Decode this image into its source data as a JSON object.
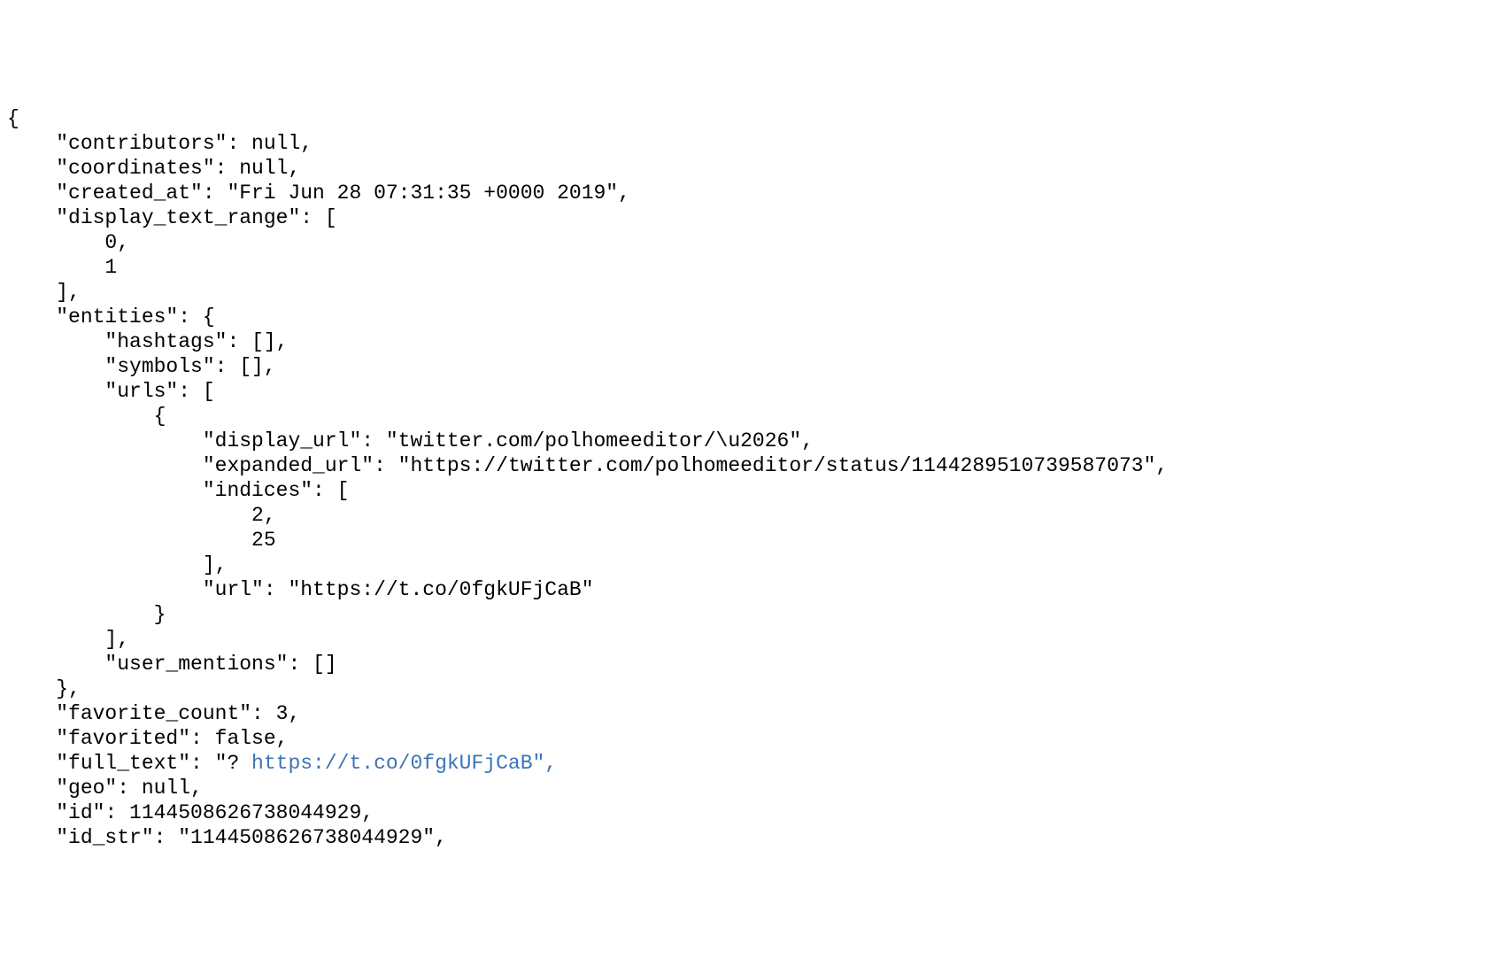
{
  "l0": "{",
  "l1": "    \"contributors\": null,",
  "l2": "    \"coordinates\": null,",
  "l3": "    \"created_at\": \"Fri Jun 28 07:31:35 +0000 2019\",",
  "l4": "    \"display_text_range\": [",
  "l5": "        0,",
  "l6": "        1",
  "l7": "    ],",
  "l8": "    \"entities\": {",
  "l9": "        \"hashtags\": [],",
  "l10": "        \"symbols\": [],",
  "l11": "        \"urls\": [",
  "l12": "            {",
  "l13": "                \"display_url\": \"twitter.com/polhomeeditor/\\u2026\",",
  "l14": "                \"expanded_url\": \"https://twitter.com/polhomeeditor/status/1144289510739587073\",",
  "l15": "                \"indices\": [",
  "l16": "                    2,",
  "l17": "                    25",
  "l18": "                ],",
  "l19": "                \"url\": \"https://t.co/0fgkUFjCaB\"",
  "l20": "            }",
  "l21": "        ],",
  "l22": "        \"user_mentions\": []",
  "l23": "    },",
  "l24": "    \"favorite_count\": 3,",
  "l25": "    \"favorited\": false,",
  "l26a": "    \"full_text\": \"? ",
  "l26b": "https://t.co/0fgkUFjCaB\",",
  "l27": "    \"geo\": null,",
  "l28": "    \"id\": 1144508626738044929,",
  "l29": "    \"id_str\": \"1144508626738044929\","
}
